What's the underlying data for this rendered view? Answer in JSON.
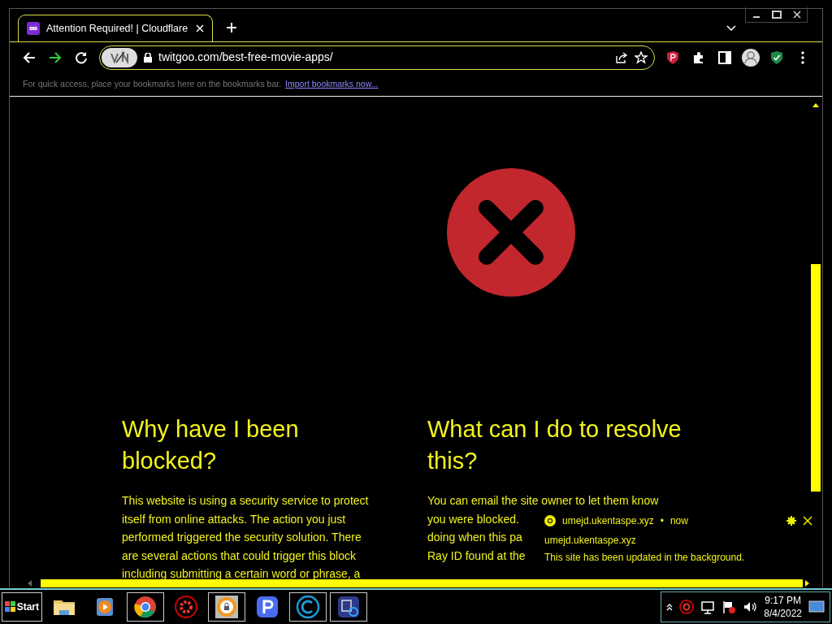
{
  "tab": {
    "title": "Attention Required! | Cloudflare",
    "selected": true
  },
  "address_bar": {
    "url": "twitgoo.com/best-free-movie-apps/"
  },
  "bookmarks_bar": {
    "hint": "For quick access, place your bookmarks here on the bookmarks bar.",
    "link": "Import bookmarks now..."
  },
  "page": {
    "sections": [
      {
        "heading": "Why have I been blocked?",
        "lines": [
          "This website is using a security service to protect",
          "itself from online attacks. The action you just",
          "performed triggered the security solution. There",
          "are several actions that could trigger this block",
          "including submitting a certain word or phrase, a"
        ]
      },
      {
        "heading": "What can I do to resolve this?",
        "lines": [
          "You can email the site owner to let them know",
          "you were blocked.",
          "doing when this pa",
          "Ray ID found at the"
        ]
      }
    ]
  },
  "notification": {
    "origin": "umejd.ukentaspe.xyz",
    "separator": "•",
    "time": "now",
    "title": "umejd.ukentaspe.xyz",
    "message": "This site has been updated in the background."
  },
  "taskbar": {
    "start": "Start",
    "time": "9:17 PM",
    "date": "8/4/2022"
  }
}
